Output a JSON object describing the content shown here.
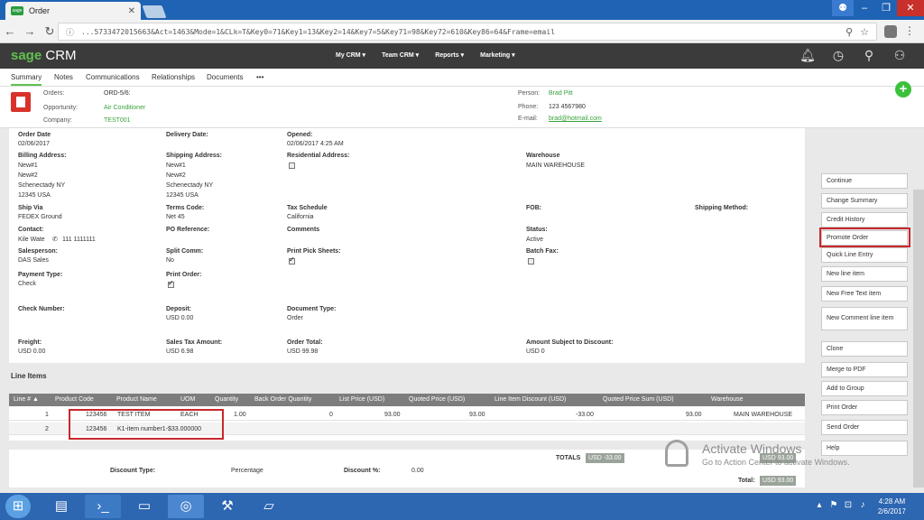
{
  "browser": {
    "tab_title": "Order",
    "favicon_text": "sage",
    "address_url": "...5733472015663&Act=1463&Mode=1&CLk=T&Key0=71&Key1=13&Key2=14&Key7=5&Key71=98&Key72=610&Key86=64&Frame=email"
  },
  "app": {
    "logo_sage": "sage",
    "logo_crm": "CRM",
    "menu": [
      "My CRM ▾",
      "Team CRM ▾",
      "Reports ▾",
      "Marketing ▾"
    ]
  },
  "tabs": [
    "Summary",
    "Notes",
    "Communications",
    "Relationships",
    "Documents",
    "•••"
  ],
  "header": {
    "orders_label": "Orders:",
    "orders_value": "ORD-5/6:",
    "opportunity_label": "Opportunity:",
    "opportunity_value": "Air Conditioner",
    "company_label": "Company:",
    "company_value": "TEST001",
    "person_label": "Person:",
    "person_value": "Brad Pitt",
    "phone_label": "Phone:",
    "phone_value": "123 4567980",
    "email_label": "E-mail:",
    "email_value": "brad@hotmail.com"
  },
  "fields": {
    "order_date_l": "Order Date",
    "order_date_v": "02/06/2017",
    "delivery_l": "Delivery Date:",
    "opened_l": "Opened:",
    "opened_v": "02/06/2017 4:25 AM",
    "billing_l": "Billing Address:",
    "billing_v1": "New#1",
    "billing_v2": "New#2",
    "billing_v3": "Schenectady NY",
    "billing_v4": "12345 USA",
    "shipping_l": "Shipping Address:",
    "shipping_v1": "New#1",
    "shipping_v2": "New#2",
    "shipping_v3": "Schenectady NY",
    "shipping_v4": "12345 USA",
    "residential_l": "Residential Address:",
    "warehouse_l": "Warehouse",
    "warehouse_v": "MAIN WAREHOUSE",
    "shipvia_l": "Ship Via",
    "shipvia_v": "FEDEX Ground",
    "terms_l": "Terms Code:",
    "terms_v": "Net 45",
    "taxsched_l": "Tax Schedule",
    "taxsched_v": "California",
    "fob_l": "FOB:",
    "shipmethod_l": "Shipping Method:",
    "contact_l": "Contact:",
    "contact_name": "Kile Wate",
    "contact_phone": "111 1111111",
    "po_l": "PO Reference:",
    "comments_l": "Comments",
    "status_l": "Status:",
    "status_v": "Active",
    "salesperson_l": "Salesperson:",
    "salesperson_v": "DAS Sales",
    "splitcomm_l": "Split Comm:",
    "splitcomm_v": "No",
    "printpick_l": "Print Pick Sheets:",
    "batchfax_l": "Batch Fax:",
    "paytype_l": "Payment Type:",
    "paytype_v": "Check",
    "printorder_l": "Print Order:",
    "checknum_l": "Check Number:",
    "deposit_l": "Deposit:",
    "deposit_v": "USD 0.00",
    "doctype_l": "Document Type:",
    "doctype_v": "Order",
    "freight_l": "Freight:",
    "freight_v": "USD 0.00",
    "salestax_l": "Sales Tax Amount:",
    "salestax_v": "USD 6.98",
    "ordertotal_l": "Order Total:",
    "ordertotal_v": "USD 99.98",
    "amountsubj_l": "Amount Subject to Discount:",
    "amountsubj_v": "USD 0"
  },
  "line_items": {
    "title": "Line Items",
    "columns": [
      "Line # ▲",
      "Product Code",
      "Product Name",
      "UOM",
      "Quantity",
      "Back Order Quantity",
      "List Price (USD)",
      "Quoted Price (USD)",
      "Line Item Discount (USD)",
      "Quoted Price Sum (USD)",
      "Warehouse"
    ],
    "rows": [
      {
        "line": "1",
        "code": "123456",
        "name": "TEST ITEM",
        "uom": "EACH",
        "qty": "1.00",
        "backorder": "0",
        "list": "93.00",
        "quoted": "93.00",
        "discount": "-33.00",
        "sum": "93.00",
        "warehouse": "MAIN WAREHOUSE"
      },
      {
        "line": "2",
        "code": "123456",
        "name": "K1-item number1-$33.000000"
      }
    ]
  },
  "totals": {
    "totals_label": "TOTALS",
    "totals_value": "USD -33.00",
    "discount_type_l": "Discount Type:",
    "discount_type_v": "Percentage",
    "discount_pct_l": "Discount %:",
    "discount_pct_v": "0.00",
    "right_value": "USD 93.00",
    "total_l": "Total:",
    "total_v": "USD 93.00"
  },
  "actions": [
    "Continue",
    "Change Summary",
    "Credit History",
    "Promote Order",
    "Quick Line Entry",
    "New line item",
    "New Free Text item",
    "New Comment line item",
    "Clone",
    "Merge to PDF",
    "Add to Group",
    "Print Order",
    "Send Order",
    "Help"
  ],
  "watermark": {
    "title": "Activate Windows",
    "sub": "Go to Action Center to activate Windows."
  },
  "clock": {
    "time": "4:28 AM",
    "date": "2/6/2017"
  }
}
